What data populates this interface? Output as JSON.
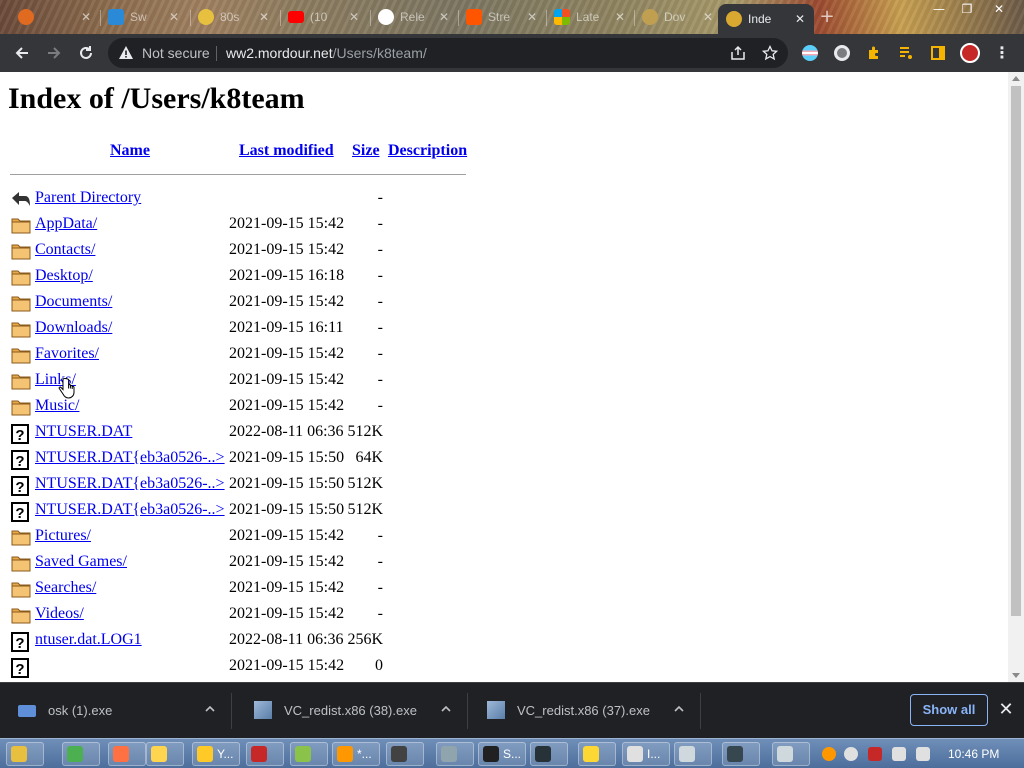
{
  "browser": {
    "tabs": [
      {
        "title": "",
        "favicon_color": "#e06a20"
      },
      {
        "title": "Sw",
        "favicon_color": "#2a8ad8"
      },
      {
        "title": "80s",
        "favicon_color": "#e8c040"
      },
      {
        "title": "(10",
        "favicon_color": "#ff0000"
      },
      {
        "title": "Rele",
        "favicon_color": "#ffffff"
      },
      {
        "title": "Stre",
        "favicon_color": "#ff5500"
      },
      {
        "title": "Late",
        "favicon_color": "#00a4ef"
      },
      {
        "title": "Dov",
        "favicon_color": "#c0a050"
      },
      {
        "title": "Inde",
        "favicon_color": "#d8a830",
        "active": true
      }
    ],
    "security_label": "Not secure",
    "url_host": "ww2.mordour.net",
    "url_path": "/Users/k8team/"
  },
  "page": {
    "title": "Index of /Users/k8team",
    "columns": {
      "name": "Name",
      "last_modified": "Last modified",
      "size": "Size",
      "description": "Description"
    },
    "entries": [
      {
        "name": "Parent Directory",
        "date": "",
        "size": "-",
        "icon": "back-icon"
      },
      {
        "name": "AppData/",
        "date": "2021-09-15 15:42",
        "size": "-",
        "icon": "folder-icon"
      },
      {
        "name": "Contacts/",
        "date": "2021-09-15 15:42",
        "size": "-",
        "icon": "folder-icon"
      },
      {
        "name": "Desktop/",
        "date": "2021-09-15 16:18",
        "size": "-",
        "icon": "folder-icon"
      },
      {
        "name": "Documents/",
        "date": "2021-09-15 15:42",
        "size": "-",
        "icon": "folder-icon"
      },
      {
        "name": "Downloads/",
        "date": "2021-09-15 16:11",
        "size": "-",
        "icon": "folder-icon"
      },
      {
        "name": "Favorites/",
        "date": "2021-09-15 15:42",
        "size": "-",
        "icon": "folder-icon"
      },
      {
        "name": "Links/",
        "date": "2021-09-15 15:42",
        "size": "-",
        "icon": "folder-icon"
      },
      {
        "name": "Music/",
        "date": "2021-09-15 15:42",
        "size": "-",
        "icon": "folder-icon"
      },
      {
        "name": "NTUSER.DAT",
        "date": "2022-08-11 06:36",
        "size": "512K",
        "icon": "unknown-file-icon"
      },
      {
        "name": "NTUSER.DAT{eb3a0526-..>",
        "date": "2021-09-15 15:50",
        "size": "64K",
        "icon": "unknown-file-icon"
      },
      {
        "name": "NTUSER.DAT{eb3a0526-..>",
        "date": "2021-09-15 15:50",
        "size": "512K",
        "icon": "unknown-file-icon"
      },
      {
        "name": "NTUSER.DAT{eb3a0526-..>",
        "date": "2021-09-15 15:50",
        "size": "512K",
        "icon": "unknown-file-icon"
      },
      {
        "name": "Pictures/",
        "date": "2021-09-15 15:42",
        "size": "-",
        "icon": "folder-icon"
      },
      {
        "name": "Saved Games/",
        "date": "2021-09-15 15:42",
        "size": "-",
        "icon": "folder-icon"
      },
      {
        "name": "Searches/",
        "date": "2021-09-15 15:42",
        "size": "-",
        "icon": "folder-icon"
      },
      {
        "name": "Videos/",
        "date": "2021-09-15 15:42",
        "size": "-",
        "icon": "folder-icon"
      },
      {
        "name": "ntuser.dat.LOG1",
        "date": "2022-08-11 06:36",
        "size": "256K",
        "icon": "unknown-file-icon"
      },
      {
        "name": "",
        "date": "2021-09-15 15:42",
        "size": "0",
        "icon": "unknown-file-icon"
      }
    ]
  },
  "downloads": {
    "items": [
      {
        "name": "osk (1).exe"
      },
      {
        "name": "VC_redist.x86 (38).exe"
      },
      {
        "name": "VC_redist.x86 (37).exe"
      }
    ],
    "show_all_label": "Show all"
  },
  "taskbar": {
    "buttons": [
      {
        "label": "",
        "color": "#e8c040"
      },
      {
        "label": "",
        "color": "#4caf50"
      },
      {
        "label": "",
        "color": "#ff7043"
      },
      {
        "label": "",
        "color": "#ffd54f"
      },
      {
        "label": "Y...",
        "color": "#ffca28"
      },
      {
        "label": "",
        "color": "#c62828"
      },
      {
        "label": "",
        "color": "#8bc34a"
      },
      {
        "label": "*...",
        "color": "#ff9800"
      },
      {
        "label": "",
        "color": "#424242"
      },
      {
        "label": "",
        "color": "#90a4ae"
      },
      {
        "label": "S...",
        "color": "#212121"
      },
      {
        "label": "",
        "color": "#263238"
      },
      {
        "label": "",
        "color": "#fdd835"
      },
      {
        "label": "I...",
        "color": "#e0e0e0"
      },
      {
        "label": "",
        "color": "#cfd8dc"
      },
      {
        "label": "",
        "color": "#37474f"
      },
      {
        "label": "",
        "color": "#cfd8dc"
      }
    ],
    "clock": "10:46 PM"
  }
}
